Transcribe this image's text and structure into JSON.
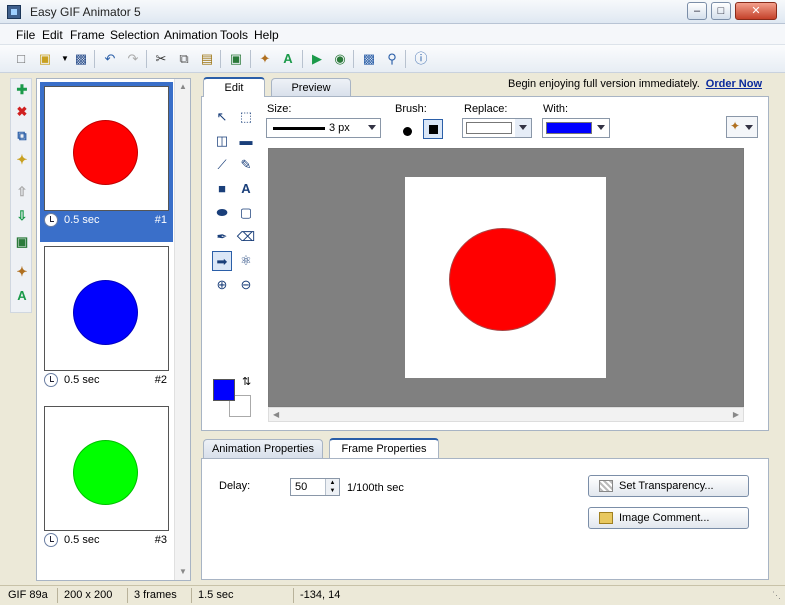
{
  "window": {
    "title": "Easy GIF Animator 5"
  },
  "menu": [
    "File",
    "Edit",
    "Frame",
    "Selection",
    "Animation",
    "Tools",
    "Help"
  ],
  "frames": [
    {
      "delay": "0.5 sec",
      "number": "#1",
      "color": "#ff0000",
      "selected": true
    },
    {
      "delay": "0.5 sec",
      "number": "#2",
      "color": "#0000ff",
      "selected": false
    },
    {
      "delay": "0.5 sec",
      "number": "#3",
      "color": "#00ff00",
      "selected": false
    }
  ],
  "editor": {
    "tabs": [
      "Edit",
      "Preview"
    ],
    "promo_text": "Begin enjoying full version immediately.",
    "promo_link": "Order Now",
    "size_label": "Size:",
    "size_value": "3 px",
    "brush_label": "Brush:",
    "replace_label": "Replace:",
    "with_label": "With:",
    "replace_color": "#ffffff",
    "with_color": "#0000ff",
    "foreground_color": "#0000ff",
    "background_color": "#ffffff",
    "image_disc_color": "#ff0000"
  },
  "properties": {
    "tabs": [
      "Animation Properties",
      "Frame Properties"
    ],
    "delay_label": "Delay:",
    "delay_value": "50",
    "delay_unit": "1/100th sec",
    "set_transparency": "Set Transparency...",
    "image_comment": "Image Comment..."
  },
  "status": {
    "format": "GIF 89a",
    "dimensions": "200 x 200",
    "frame_count": "3 frames",
    "total_time": "1.5 sec",
    "coords": "-134, 14"
  }
}
